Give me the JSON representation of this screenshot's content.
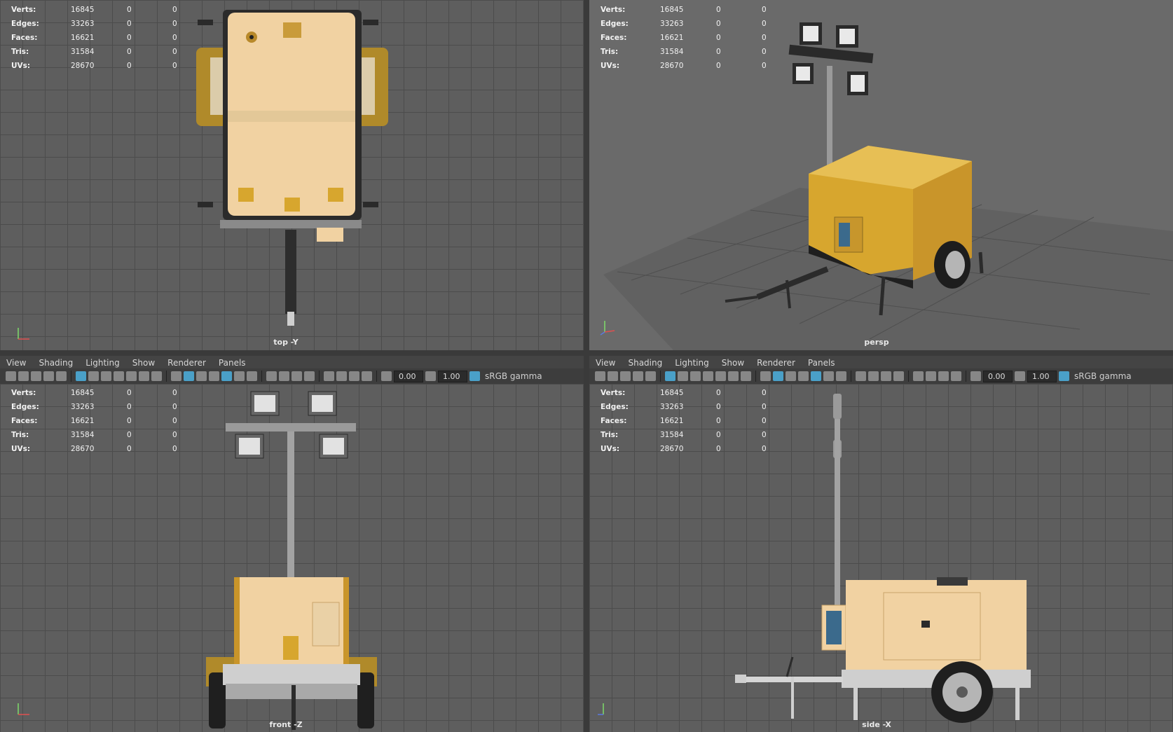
{
  "hud": {
    "rows": [
      {
        "label": "Verts:",
        "v1": "16845",
        "v2": "0",
        "v3": "0"
      },
      {
        "label": "Edges:",
        "v1": "33263",
        "v2": "0",
        "v3": "0"
      },
      {
        "label": "Faces:",
        "v1": "16621",
        "v2": "0",
        "v3": "0"
      },
      {
        "label": "Tris:",
        "v1": "31584",
        "v2": "0",
        "v3": "0"
      },
      {
        "label": "UVs:",
        "v1": "28670",
        "v2": "0",
        "v3": "0"
      }
    ]
  },
  "viewports": {
    "top": {
      "camera": "top -Y"
    },
    "persp": {
      "camera": "persp"
    },
    "front": {
      "camera": "front -Z"
    },
    "side": {
      "camera": "side -X"
    }
  },
  "menu": {
    "items": [
      "View",
      "Shading",
      "Lighting",
      "Show",
      "Renderer",
      "Panels"
    ]
  },
  "toolbar": {
    "exposure": "0.00",
    "gamma": "1.00",
    "colorspace": "sRGB gamma"
  },
  "colors": {
    "body": "#f1d2a2",
    "body_3d": "#d7a62e",
    "frame": "#2b2b2b",
    "accent": "#4aa0c8"
  }
}
